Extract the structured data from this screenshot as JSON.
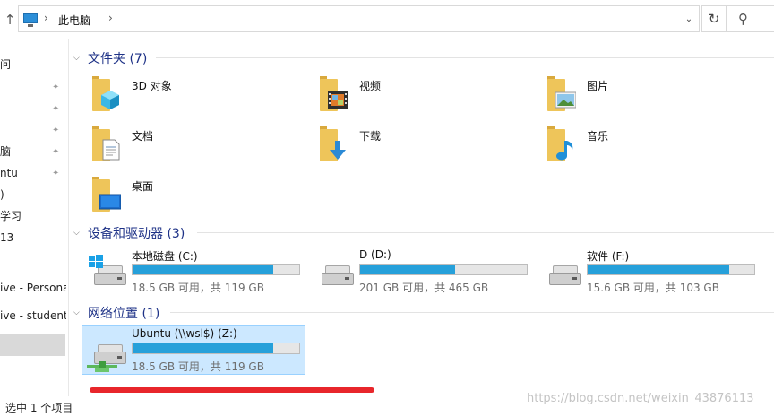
{
  "address": {
    "crumbs": [
      "此电脑"
    ],
    "up_icon": "up-arrow-icon",
    "refresh_icon": "refresh-icon",
    "search_icon": "search-icon"
  },
  "nav": {
    "items": [
      {
        "label": "问",
        "pinned": false
      },
      {
        "label": "",
        "pinned": true
      },
      {
        "label": "",
        "pinned": true
      },
      {
        "label": "",
        "pinned": true
      },
      {
        "label": "脑",
        "pinned": true
      },
      {
        "label": "ntu",
        "pinned": true
      },
      {
        "label": ")",
        "pinned": false
      },
      {
        "label": "学习",
        "pinned": false
      },
      {
        "label": "13",
        "pinned": false
      },
      {
        "label": "ive - Persona",
        "pinned": false
      },
      {
        "label": "ive - student",
        "pinned": false
      }
    ]
  },
  "sections": {
    "folders": {
      "title": "文件夹 (7)"
    },
    "drives": {
      "title": "设备和驱动器 (3)"
    },
    "network": {
      "title": "网络位置 (1)"
    }
  },
  "folders": [
    {
      "label": "3D 对象",
      "icon": "3d-objects-icon"
    },
    {
      "label": "视频",
      "icon": "videos-icon"
    },
    {
      "label": "图片",
      "icon": "pictures-icon"
    },
    {
      "label": "文档",
      "icon": "documents-icon"
    },
    {
      "label": "下载",
      "icon": "downloads-icon"
    },
    {
      "label": "音乐",
      "icon": "music-icon"
    },
    {
      "label": "桌面",
      "icon": "desktop-icon"
    }
  ],
  "drives": [
    {
      "name": "本地磁盘 (C:)",
      "info": "18.5 GB 可用，共 119 GB",
      "used_fraction": 0.845,
      "icon": "windows-drive-icon"
    },
    {
      "name": "D (D:)",
      "info": "201 GB 可用，共 465 GB",
      "used_fraction": 0.568,
      "icon": "hard-drive-icon"
    },
    {
      "name": "软件 (F:)",
      "info": "15.6 GB 可用，共 103 GB",
      "used_fraction": 0.849,
      "icon": "hard-drive-icon"
    }
  ],
  "network": [
    {
      "name": "Ubuntu (\\\\wsl$) (Z:)",
      "info": "18.5 GB 可用，共 119 GB",
      "used_fraction": 0.845,
      "icon": "network-drive-icon"
    }
  ],
  "status": {
    "text": "选中 1 个项目"
  },
  "watermark": "https://blog.csdn.net/weixin_43876113",
  "colors": {
    "bar_fill": "#26a0da",
    "section_title": "#1e3287",
    "selection": "#cce8ff",
    "annotation": "#e8262b"
  }
}
